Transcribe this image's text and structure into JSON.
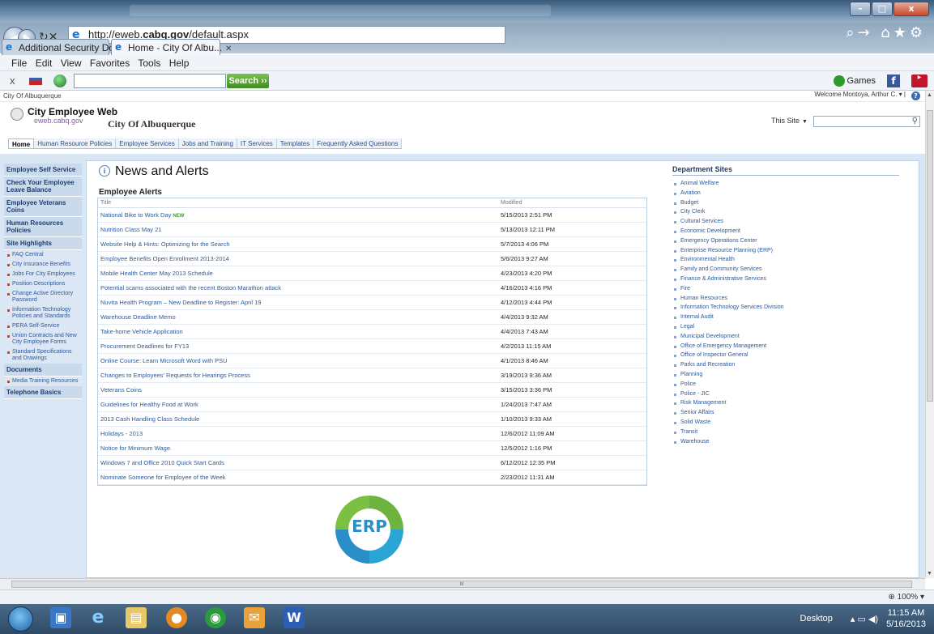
{
  "browser": {
    "url_prefix": "http://eweb.",
    "url_domain": "cabq.gov",
    "url_path": "/default.aspx",
    "tabs": [
      {
        "label": "Additional Security Do..."
      },
      {
        "label": "Home - City Of Albu..."
      }
    ],
    "menu": [
      "File",
      "Edit",
      "View",
      "Favorites",
      "Tools",
      "Help"
    ],
    "search_button": "Search",
    "games_label": "Games",
    "zoom": "100%"
  },
  "site": {
    "breadcrumb": "City Of Albuquerque",
    "welcome": "Welcome Montoya, Arthur C.",
    "brand": "City Employee Web",
    "brand_sub": "eweb.cabq.gov",
    "title": "City Of Albuquerque",
    "search_scope": "This Site",
    "topnav": [
      "Home",
      "Human Resource Policies",
      "Employee Services",
      "Jobs and Training",
      "IT Services",
      "Templates",
      "Frequently Asked Questions"
    ]
  },
  "leftnav": [
    {
      "type": "head",
      "label": "Employee Self Service"
    },
    {
      "type": "head",
      "label": "Check Your Employee Leave Balance"
    },
    {
      "type": "head",
      "label": "Employee Veterans Coins"
    },
    {
      "type": "head",
      "label": "Human Resources Policies"
    },
    {
      "type": "head",
      "label": "Site Highlights"
    },
    {
      "type": "item",
      "label": "FAQ Central"
    },
    {
      "type": "item",
      "label": "City Insurance Benefits"
    },
    {
      "type": "item",
      "label": "Jobs For City Employees"
    },
    {
      "type": "item",
      "label": "Position Descriptions"
    },
    {
      "type": "item",
      "label": "Change Active Directory Password"
    },
    {
      "type": "item",
      "label": "Information Technology Policies and Standards"
    },
    {
      "type": "item",
      "label": "PERA Self-Service"
    },
    {
      "type": "item",
      "label": "Union Contracts and New City Employee Forms"
    },
    {
      "type": "item",
      "label": "Standard Specifications and Drawings"
    },
    {
      "type": "head",
      "label": "Documents"
    },
    {
      "type": "item",
      "label": "Media Training Resources"
    },
    {
      "type": "head",
      "label": "Telephone Basics"
    }
  ],
  "news": {
    "title": "News and Alerts",
    "alerts_heading": "Employee Alerts",
    "col_title": "Title",
    "col_modified": "Modified",
    "new_badge": "NEW",
    "rows": [
      {
        "title": "National Bike to Work Day",
        "modified": "5/15/2013 2:51 PM",
        "new": true
      },
      {
        "title": "Nutrition Class May 21",
        "modified": "5/13/2013 12:11 PM"
      },
      {
        "title": "Website Help & Hints: Optimizing for the Search",
        "modified": "5/7/2013 4:06 PM"
      },
      {
        "title": "Employee Benefits Open Enrollment 2013-2014",
        "modified": "5/6/2013 9:27 AM"
      },
      {
        "title": "Mobile Health Center May 2013 Schedule",
        "modified": "4/23/2013 4:20 PM"
      },
      {
        "title": "Potential scams associated with the recent Boston Marathon attack",
        "modified": "4/16/2013 4:16 PM"
      },
      {
        "title": "Nuvita Health Program – New Deadline to Register: April 19",
        "modified": "4/12/2013 4:44 PM"
      },
      {
        "title": "Warehouse Deadline Memo",
        "modified": "4/4/2013 9:32 AM"
      },
      {
        "title": "Take-home Vehicle Application",
        "modified": "4/4/2013 7:43 AM"
      },
      {
        "title": "Procurement Deadlines for FY13",
        "modified": "4/2/2013 11:15 AM"
      },
      {
        "title": "Online Course: Learn Microsoft Word with PSU",
        "modified": "4/1/2013 8:46 AM"
      },
      {
        "title": "Changes to Employees' Requests for Hearings Process",
        "modified": "3/19/2013 9:36 AM"
      },
      {
        "title": "Veterans Coins",
        "modified": "3/15/2013 3:36 PM"
      },
      {
        "title": "Guidelines for Healthy Food at Work",
        "modified": "1/24/2013 7:47 AM"
      },
      {
        "title": "2013 Cash Handling Class Schedule",
        "modified": "1/10/2013 9:33 AM"
      },
      {
        "title": "Holidays - 2013",
        "modified": "12/6/2012 11:09 AM"
      },
      {
        "title": "Notice for Minimum Wage",
        "modified": "12/5/2012 1:16 PM"
      },
      {
        "title": "Windows 7 and Office 2010 Quick Start Cards",
        "modified": "6/12/2012 12:35 PM"
      },
      {
        "title": "Nominate Someone for Employee of the Week",
        "modified": "2/23/2012 11:31 AM"
      }
    ]
  },
  "erp_logo_text": "ERP",
  "departments": {
    "heading": "Department Sites",
    "items": [
      "Animal Welfare",
      "Aviation",
      "Budget",
      "City Clerk",
      "Cultural Services",
      "Economic Development",
      "Emergency Operations Center",
      "Enterprise Resource Planning (ERP)",
      "Environmental Health",
      "Family and Community Services",
      "Finance & Administrative Services",
      "Fire",
      "Human Resources",
      "Information Technology Services Division",
      "Internal Audit",
      "Legal",
      "Municipal Development",
      "Office of Emergency Management",
      "Office of Inspector General",
      "Parks and Recreation",
      "Planning",
      "Police",
      "Police - JIC",
      "Risk Management",
      "Senior Affairs",
      "Solid Waste",
      "Transit",
      "Warehouse"
    ]
  },
  "taskbar": {
    "desktop": "Desktop",
    "time": "11:15 AM",
    "date": "5/16/2013"
  }
}
